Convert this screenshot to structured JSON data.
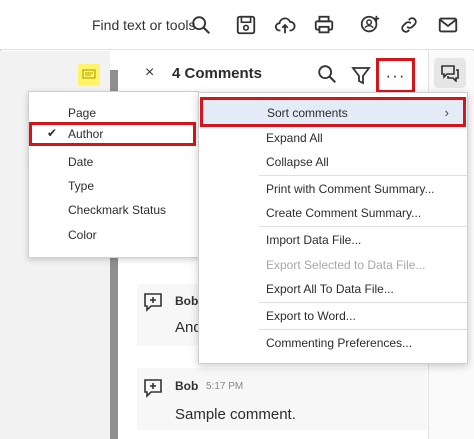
{
  "toolbar": {
    "find_label": "Find text or tools",
    "icons": [
      "search-icon",
      "save-icon",
      "upload-cloud-icon",
      "print-icon",
      "share-user-icon",
      "link-icon",
      "mail-icon"
    ]
  },
  "panel": {
    "close_glyph": "×",
    "title": "4 Comments",
    "more_glyph": "···"
  },
  "sort_submenu": {
    "items": [
      {
        "label": "Page",
        "checked": false
      },
      {
        "label": "Author",
        "checked": true
      },
      {
        "label": "Date",
        "checked": false
      },
      {
        "label": "Type",
        "checked": false
      },
      {
        "label": "Checkmark Status",
        "checked": false
      },
      {
        "label": "Color",
        "checked": false
      }
    ],
    "check_glyph": "✔"
  },
  "options_menu": {
    "items": [
      {
        "label": "Sort comments",
        "has_submenu": true,
        "disabled": false
      },
      {
        "label": "Expand All",
        "disabled": false
      },
      {
        "label": "Collapse All",
        "disabled": false
      },
      {
        "label": "Print with Comment Summary...",
        "disabled": false
      },
      {
        "label": "Create Comment Summary...",
        "disabled": false
      },
      {
        "label": "Import Data File...",
        "disabled": false
      },
      {
        "label": "Export Selected to Data File...",
        "disabled": true
      },
      {
        "label": "Export All To Data File...",
        "disabled": false
      },
      {
        "label": "Export to Word...",
        "disabled": false
      },
      {
        "label": "Commenting Preferences...",
        "disabled": false
      }
    ],
    "submenu_arrow": "›"
  },
  "comments": [
    {
      "author": "Bob",
      "time": "",
      "text": "And"
    },
    {
      "author": "Bob",
      "time": "5:17 PM",
      "text": "Sample comment."
    }
  ],
  "colors": {
    "highlight_red": "#d6141c",
    "active_row": "#e3ebf7",
    "sticky_yellow": "#fff36b"
  }
}
